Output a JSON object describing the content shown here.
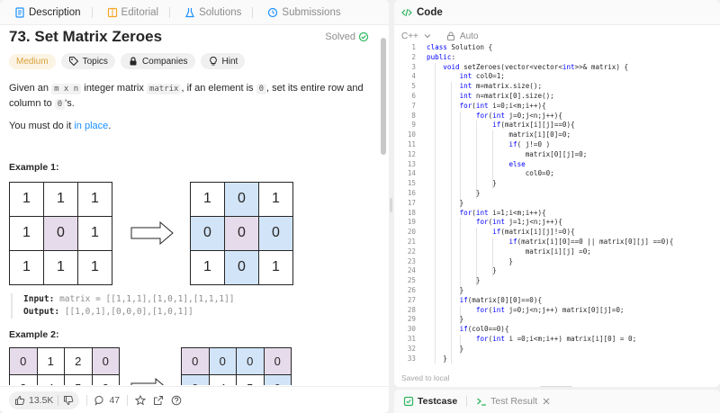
{
  "left_tabs": [
    {
      "label": "Description",
      "icon": "description-icon",
      "color": "#1a90ff"
    },
    {
      "label": "Editorial",
      "icon": "editorial-icon",
      "color": "#f5a623"
    },
    {
      "label": "Solutions",
      "icon": "flask-icon",
      "color": "#1a90ff"
    },
    {
      "label": "Submissions",
      "icon": "history-icon",
      "color": "#1a90ff"
    }
  ],
  "problem": {
    "title": "73. Set Matrix Zeroes",
    "solved_label": "Solved",
    "difficulty": "Medium",
    "chips": [
      "Topics",
      "Companies",
      "Hint"
    ],
    "desc_parts": [
      "Given an ",
      "m x n",
      " integer matrix ",
      "matrix",
      ", if an element is ",
      "0",
      ", set its entire row and column to ",
      "0",
      "'s."
    ],
    "desc2_prefix": "You must do it ",
    "desc2_link": "in place",
    "desc2_suffix": "."
  },
  "example1": {
    "title": "Example 1:",
    "input_matrix": [
      [
        "1",
        "1",
        "1"
      ],
      [
        "1",
        "0",
        "1"
      ],
      [
        "1",
        "1",
        "1"
      ]
    ],
    "output_matrix": [
      [
        "1",
        "0",
        "1"
      ],
      [
        "0",
        "0",
        "0"
      ],
      [
        "1",
        "0",
        "1"
      ]
    ],
    "input_label": "Input:",
    "input_value": "matrix = [[1,1,1],[1,0,1],[1,1,1]]",
    "output_label": "Output:",
    "output_value": "[[1,0,1],[0,0,0],[1,0,1]]"
  },
  "example2": {
    "title": "Example 2:",
    "input_matrix": [
      [
        "0",
        "1",
        "2",
        "0"
      ],
      [
        "3",
        "4",
        "5",
        "2"
      ]
    ],
    "output_matrix": [
      [
        "0",
        "0",
        "0",
        "0"
      ],
      [
        "0",
        "4",
        "5",
        "0"
      ]
    ]
  },
  "bottom_bar": {
    "likes": "13.5K",
    "comments": "47"
  },
  "right_panel": {
    "title": "Code",
    "language": "C++",
    "auto_label": "Auto",
    "saved_label": "Saved to local",
    "testcase_label": "Testcase",
    "result_label": "Test Result"
  },
  "code_lines": [
    "class Solution {",
    "public:",
    "    void setZeroes(vector<vector<int>>& matrix) {",
    "        int col0=1;",
    "        int m=matrix.size();",
    "        int n=matrix[0].size();",
    "        for(int i=0;i<m;i++){",
    "            for(int j=0;j<n;j++){",
    "                if(matrix[i][j]==0){",
    "                    matrix[i][0]=0;",
    "                    if( j!=0 )",
    "                        matrix[0][j]=0;",
    "                    else",
    "                        col0=0;",
    "                }",
    "            }",
    "        }",
    "        for(int i=1;i<m;i++){",
    "            for(int j=1;j<n;j++){",
    "                if(matrix[i][j]!=0){",
    "                    if(matrix[i][0]==0 || matrix[0][j] ==0){",
    "                        matrix[i][j] =0;",
    "                    }",
    "                }",
    "            }",
    "        }",
    "        if(matrix[0][0]==0){",
    "            for(int j=0;j<n;j++) matrix[0][j]=0;",
    "        }",
    "        if(col0==0){",
    "            for(int i =0;i<m;i++) matrix[i][0] = 0;",
    "        }",
    "    }",
    "};"
  ],
  "colors": {
    "accent_blue": "#1a90ff",
    "solved_green": "#2db55d",
    "medium": "#d9a23b",
    "highlight_purple": "#e6dbeb",
    "highlight_blue": "#d2e4f7",
    "keyword": "#0000ff"
  }
}
